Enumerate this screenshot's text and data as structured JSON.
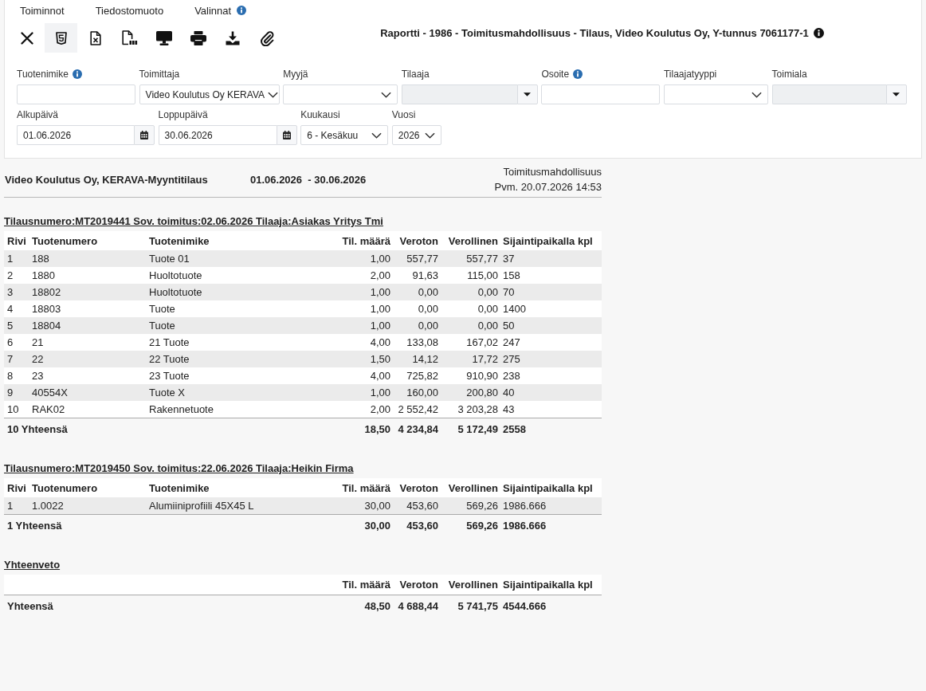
{
  "menu": [
    {
      "label": "Toiminnot",
      "info": false
    },
    {
      "label": "Tiedostomuoto",
      "info": false
    },
    {
      "label": "Valinnat",
      "info": true
    }
  ],
  "toolbar": [
    {
      "kind": "close",
      "selected": false
    },
    {
      "kind": "html",
      "selected": true
    },
    {
      "kind": "excel",
      "selected": false
    },
    {
      "kind": "pdf",
      "selected": false
    },
    {
      "kind": "screen",
      "selected": false
    },
    {
      "kind": "print",
      "selected": false
    },
    {
      "kind": "download",
      "selected": false
    },
    {
      "kind": "attach",
      "selected": false
    }
  ],
  "report_title": {
    "text": "Raportti - 1986 - Toimitusmahdollisuus - Tilaus, Video Koulutus Oy, Y-tunnus 7061177-1",
    "info": true
  },
  "filter_rows": [
    [
      {
        "label": "Tuotenimike",
        "kind": "text",
        "info": true,
        "disabled": false
      },
      {
        "label": "Toimittaja",
        "kind": "select",
        "value": "Video Koulutus Oy KERAVA",
        "info": false,
        "disabled": false
      },
      {
        "label": "Myyjä",
        "kind": "select",
        "info": false,
        "disabled": false
      },
      {
        "label": "Tilaaja",
        "kind": "lookup",
        "info": false,
        "disabled": true
      },
      {
        "label": "Osoite",
        "kind": "text",
        "info": true,
        "disabled": false
      },
      {
        "label": "Tilaajatyyppi",
        "kind": "select",
        "info": false,
        "disabled": false
      },
      {
        "label": "Toimiala",
        "kind": "lookup",
        "info": false,
        "disabled": true
      }
    ],
    [
      {
        "label": "Alkupäivä",
        "kind": "date",
        "value": "01.06.2026",
        "info": false,
        "disabled": false
      },
      {
        "label": "Loppupäivä",
        "kind": "date",
        "value": "30.06.2026",
        "info": false,
        "disabled": false
      },
      {
        "label": "Kuukausi",
        "kind": "select",
        "value": "6 - Kesäkuu",
        "info": false,
        "disabled": false
      },
      {
        "label": "Vuosi",
        "kind": "select",
        "value": "2026",
        "info": false,
        "disabled": false
      }
    ]
  ],
  "report": {
    "company": "Video Koulutus Oy, KERAVA-Myyntitilaus",
    "period": "01.06.2026  - 30.06.2026",
    "report_type": "Toimitusmahdollisuus",
    "printed": "Pvm. 20.07.2026 14:53"
  },
  "orders": [
    {
      "heading": "Tilausnumero:MT2019441 Sov. toimitus:02.06.2026 Tilaaja:Asiakas Yritys Tmi",
      "columns": [
        "Rivi",
        "Tuotenumero",
        "Tuotenimike",
        "Til. määrä",
        "Veroton",
        "Verollinen",
        "Sijaintipaikalla kpl"
      ],
      "rows": [
        [
          "1",
          "188",
          "Tuote 01",
          "1,00",
          "557,77",
          "557,77",
          "37"
        ],
        [
          "2",
          "1880",
          "Huoltotuote",
          "2,00",
          "91,63",
          "115,00",
          "158"
        ],
        [
          "3",
          "18802",
          "Huoltotuote",
          "1,00",
          "0,00",
          "0,00",
          "70"
        ],
        [
          "4",
          "18803",
          "Tuote",
          "1,00",
          "0,00",
          "0,00",
          "1400"
        ],
        [
          "5",
          "18804",
          "Tuote",
          "1,00",
          "0,00",
          "0,00",
          "50"
        ],
        [
          "6",
          "21",
          "21 Tuote",
          "4,00",
          "133,08",
          "167,02",
          "247"
        ],
        [
          "7",
          "22",
          "22 Tuote",
          "1,50",
          "14,12",
          "17,72",
          "275"
        ],
        [
          "8",
          "23",
          "23 Tuote",
          "4,00",
          "725,82",
          "910,90",
          "238"
        ],
        [
          "9",
          "40554X",
          "Tuote X",
          "1,00",
          "160,00",
          "200,80",
          "40"
        ],
        [
          "10",
          "RAK02",
          "Rakennetuote",
          "2,00",
          "2 552,42",
          "3 203,28",
          "43"
        ]
      ],
      "total": {
        "label": "10 Yhteensä",
        "values": [
          "18,50",
          "4 234,84",
          "5 172,49",
          "2558"
        ]
      }
    },
    {
      "heading": "Tilausnumero:MT2019450 Sov. toimitus:22.06.2026 Tilaaja:Heikin Firma",
      "columns": [
        "Rivi",
        "Tuotenumero",
        "Tuotenimike",
        "Til. määrä",
        "Veroton",
        "Verollinen",
        "Sijaintipaikalla kpl"
      ],
      "rows": [
        [
          "1",
          "1.0022",
          "Alumiiniprofiili 45X45 L",
          "30,00",
          "453,60",
          "569,26",
          "1986.666"
        ]
      ],
      "total": {
        "label": "1 Yhteensä",
        "values": [
          "30,00",
          "453,60",
          "569,26",
          "1986.666"
        ]
      }
    }
  ],
  "summary": {
    "heading": "Yhteenveto",
    "columns": [
      "Til. määrä",
      "Veroton",
      "Verollinen",
      "Sijaintipaikalla kpl"
    ],
    "total": {
      "label": "Yhteensä",
      "values": [
        "48,50",
        "4 688,44",
        "5 741,75",
        "4544.666"
      ]
    }
  }
}
